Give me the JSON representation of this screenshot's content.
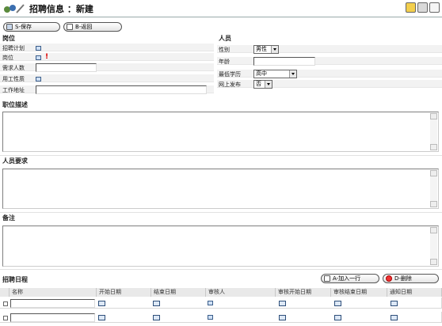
{
  "window": {
    "title": "招聘信息 ：新建"
  },
  "toolbar": {
    "save_label": "S-保存",
    "back_label": "B-返回"
  },
  "position_section": {
    "heading": "岗位",
    "fields": {
      "plan_label": "招聘计划",
      "post_label": "岗位",
      "headcount_label": "需求人数",
      "employment_label": "用工性质",
      "work_address_label": "工作地址"
    }
  },
  "person_section": {
    "heading": "人员",
    "fields": {
      "gender_label": "性别",
      "gender_value": "男性",
      "age_label": "年龄",
      "education_label": "最低学历",
      "education_value": "高中",
      "publish_label": "网上发布",
      "publish_value": "否"
    }
  },
  "description_section": {
    "heading": "职位描述"
  },
  "requirements_section": {
    "heading": "人员要求"
  },
  "notes_section": {
    "heading": "备注"
  },
  "schedule_section": {
    "heading": "招聘日程",
    "add_row_label": "A-加入一行",
    "delete_label": "D-删除",
    "columns": [
      "名称",
      "开始日期",
      "结束日期",
      "审核人",
      "审核开始日期",
      "审核结束日期",
      "通知日期"
    ]
  }
}
